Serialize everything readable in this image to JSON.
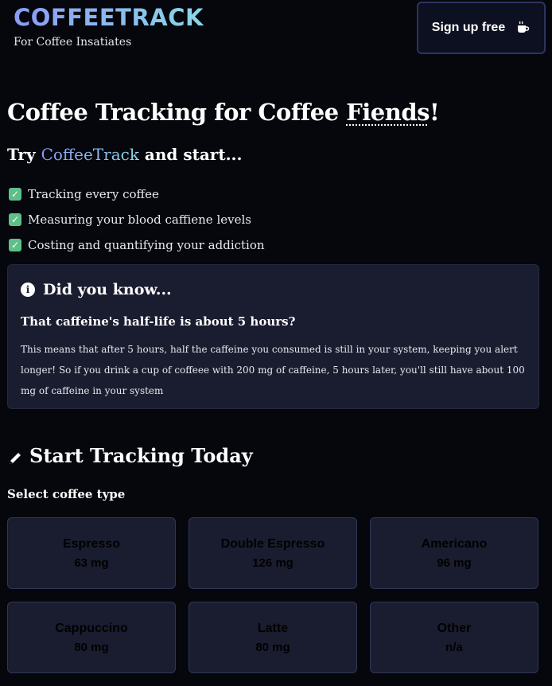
{
  "header": {
    "logo": "COFFEETRACK",
    "tagline": "For Coffee Insatiates",
    "signup_label": "Sign up free",
    "signup_icon": "mug-hot-icon"
  },
  "hero": {
    "title_prefix": "Coffee Tracking for Coffee ",
    "title_emph": "Fiends",
    "title_suffix": "!",
    "try_prefix": "Try ",
    "try_brand": "CoffeeTrack",
    "try_suffix": " and start...",
    "features": [
      "Tracking every coffee",
      "Measuring your blood caffiene levels",
      "Costing and quantifying your addiction"
    ]
  },
  "info": {
    "heading": "Did you know...",
    "question": "That caffeine's half-life is about 5 hours?",
    "body": "This means that after 5 hours, half the caffeine you consumed is still in your system, keeping you alert longer! So if you drink a cup of coffeee with 200 mg of caffeine, 5 hours later, you'll still have about 100 mg of caffeine in your system"
  },
  "tracking": {
    "title": "Start Tracking Today",
    "select_label": "Select coffee type",
    "coffees": [
      {
        "name": "Espresso",
        "caffeine": "63 mg"
      },
      {
        "name": "Double Espresso",
        "caffeine": "126 mg"
      },
      {
        "name": "Americano",
        "caffeine": "96 mg"
      },
      {
        "name": "Cappuccino",
        "caffeine": "80 mg"
      },
      {
        "name": "Latte",
        "caffeine": "80 mg"
      },
      {
        "name": "Other",
        "caffeine": "n/a"
      }
    ]
  },
  "colors": {
    "background": "#05070d",
    "card": "#1a1d2f",
    "accent_start": "#8b9bf5",
    "accent_end": "#8ad7e8",
    "check": "#5fbf8a"
  }
}
